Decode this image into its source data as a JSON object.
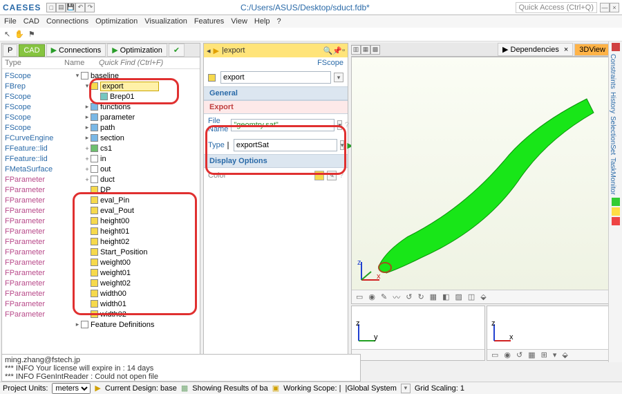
{
  "app": {
    "brand": "CAESES",
    "title_path": "C:/Users/ASUS/Desktop/sduct.fdb*",
    "quick_access": "Quick Access (Ctrl+Q)"
  },
  "menu": [
    "File",
    "CAD",
    "Connections",
    "Optimization",
    "Visualization",
    "Features",
    "View",
    "Help",
    "?"
  ],
  "left_tabs": {
    "cad": "CAD",
    "conn": "Connections",
    "opt": "Optimization"
  },
  "tree_header": {
    "type": "Type",
    "name": "Name",
    "quickfind": "Quick Find (Ctrl+F)"
  },
  "tree": [
    {
      "type": "",
      "name": "baseline",
      "icon": "white",
      "indent": 0,
      "exp": "▾"
    },
    {
      "type": "",
      "name": "export",
      "icon": "yellow",
      "indent": 1,
      "exp": "▾",
      "sel": true
    },
    {
      "type": "",
      "name": "Brep01",
      "icon": "teal",
      "indent": 2,
      "exp": "",
      "circ": true
    },
    {
      "type": "",
      "name": "functions",
      "icon": "blue",
      "indent": 1,
      "exp": "▸"
    },
    {
      "type": "",
      "name": "parameter",
      "icon": "blue",
      "indent": 1,
      "exp": "▸"
    },
    {
      "type": "",
      "name": "path",
      "icon": "blue",
      "indent": 1,
      "exp": "▸"
    },
    {
      "type": "",
      "name": "section",
      "icon": "blue",
      "indent": 1,
      "exp": "▸"
    },
    {
      "type": "",
      "name": "cs1",
      "icon": "green",
      "indent": 1,
      "exp": "+"
    },
    {
      "type": "",
      "name": "in",
      "icon": "white",
      "indent": 1,
      "exp": "+"
    },
    {
      "type": "",
      "name": "out",
      "icon": "white",
      "indent": 1,
      "exp": "+"
    },
    {
      "type": "",
      "name": "duct",
      "icon": "white",
      "indent": 1,
      "exp": "+"
    },
    {
      "type": "",
      "name": "DP",
      "icon": "yellow",
      "indent": 1,
      "exp": ""
    },
    {
      "type": "",
      "name": "eval_Pin",
      "icon": "yellow",
      "indent": 1,
      "exp": ""
    },
    {
      "type": "",
      "name": "eval_Pout",
      "icon": "yellow",
      "indent": 1,
      "exp": ""
    },
    {
      "type": "",
      "name": "height00",
      "icon": "yellow",
      "indent": 1,
      "exp": ""
    },
    {
      "type": "",
      "name": "height01",
      "icon": "yellow",
      "indent": 1,
      "exp": ""
    },
    {
      "type": "",
      "name": "height02",
      "icon": "yellow",
      "indent": 1,
      "exp": ""
    },
    {
      "type": "",
      "name": "Start_Position",
      "icon": "yellow",
      "indent": 1,
      "exp": ""
    },
    {
      "type": "",
      "name": "weight00",
      "icon": "yellow",
      "indent": 1,
      "exp": ""
    },
    {
      "type": "",
      "name": "weight01",
      "icon": "yellow",
      "indent": 1,
      "exp": ""
    },
    {
      "type": "",
      "name": "weight02",
      "icon": "yellow",
      "indent": 1,
      "exp": ""
    },
    {
      "type": "",
      "name": "width00",
      "icon": "yellow",
      "indent": 1,
      "exp": ""
    },
    {
      "type": "",
      "name": "width01",
      "icon": "yellow",
      "indent": 1,
      "exp": ""
    },
    {
      "type": "",
      "name": "width02",
      "icon": "yellow",
      "indent": 1,
      "exp": ""
    },
    {
      "type": "",
      "name": "Feature Definitions",
      "icon": "white",
      "indent": 0,
      "exp": "▸"
    }
  ],
  "type_labels": [
    "FScope",
    "FBrep",
    "FScope",
    "FScope",
    "FScope",
    "FScope",
    "FCurveEngine",
    "FFeature::lid",
    "FFeature::lid",
    "FMetaSurface",
    "FParameter",
    "FParameter",
    "FParameter",
    "FParameter",
    "FParameter",
    "FParameter",
    "FParameter",
    "FParameter",
    "FParameter",
    "FParameter",
    "FParameter",
    "FParameter",
    "FParameter",
    "FParameter"
  ],
  "props": {
    "breadcrumb": "|export",
    "scope_label": "FScope",
    "name_value": "export",
    "sec_general": "General",
    "sec_export": "Export",
    "filename_label": "File Name",
    "filename_value": "\"geomtry.sat\"",
    "type_label": "Type",
    "type_value": "exportSat",
    "sec_display": "Display Options",
    "color_label": "Color"
  },
  "right_tabs": {
    "dep": "Dependencies",
    "view": "3DView"
  },
  "sidetabs": [
    "Constraints",
    "History",
    "SelectionSet",
    "TaskMonitor"
  ],
  "console": {
    "l1": "ming.zhang@fstech.jp",
    "l2": "*** INFO Your license will expire in : 14 days",
    "l3": "*** INFO FGenIntReader : Could not open file"
  },
  "status": {
    "units_label": "Project Units:",
    "units_value": "meters",
    "design": "Current Design: base",
    "results": "Showing Results of ba",
    "scope": "Working Scope: |",
    "system": "|Global System",
    "grid": "Grid Scaling: 1"
  }
}
